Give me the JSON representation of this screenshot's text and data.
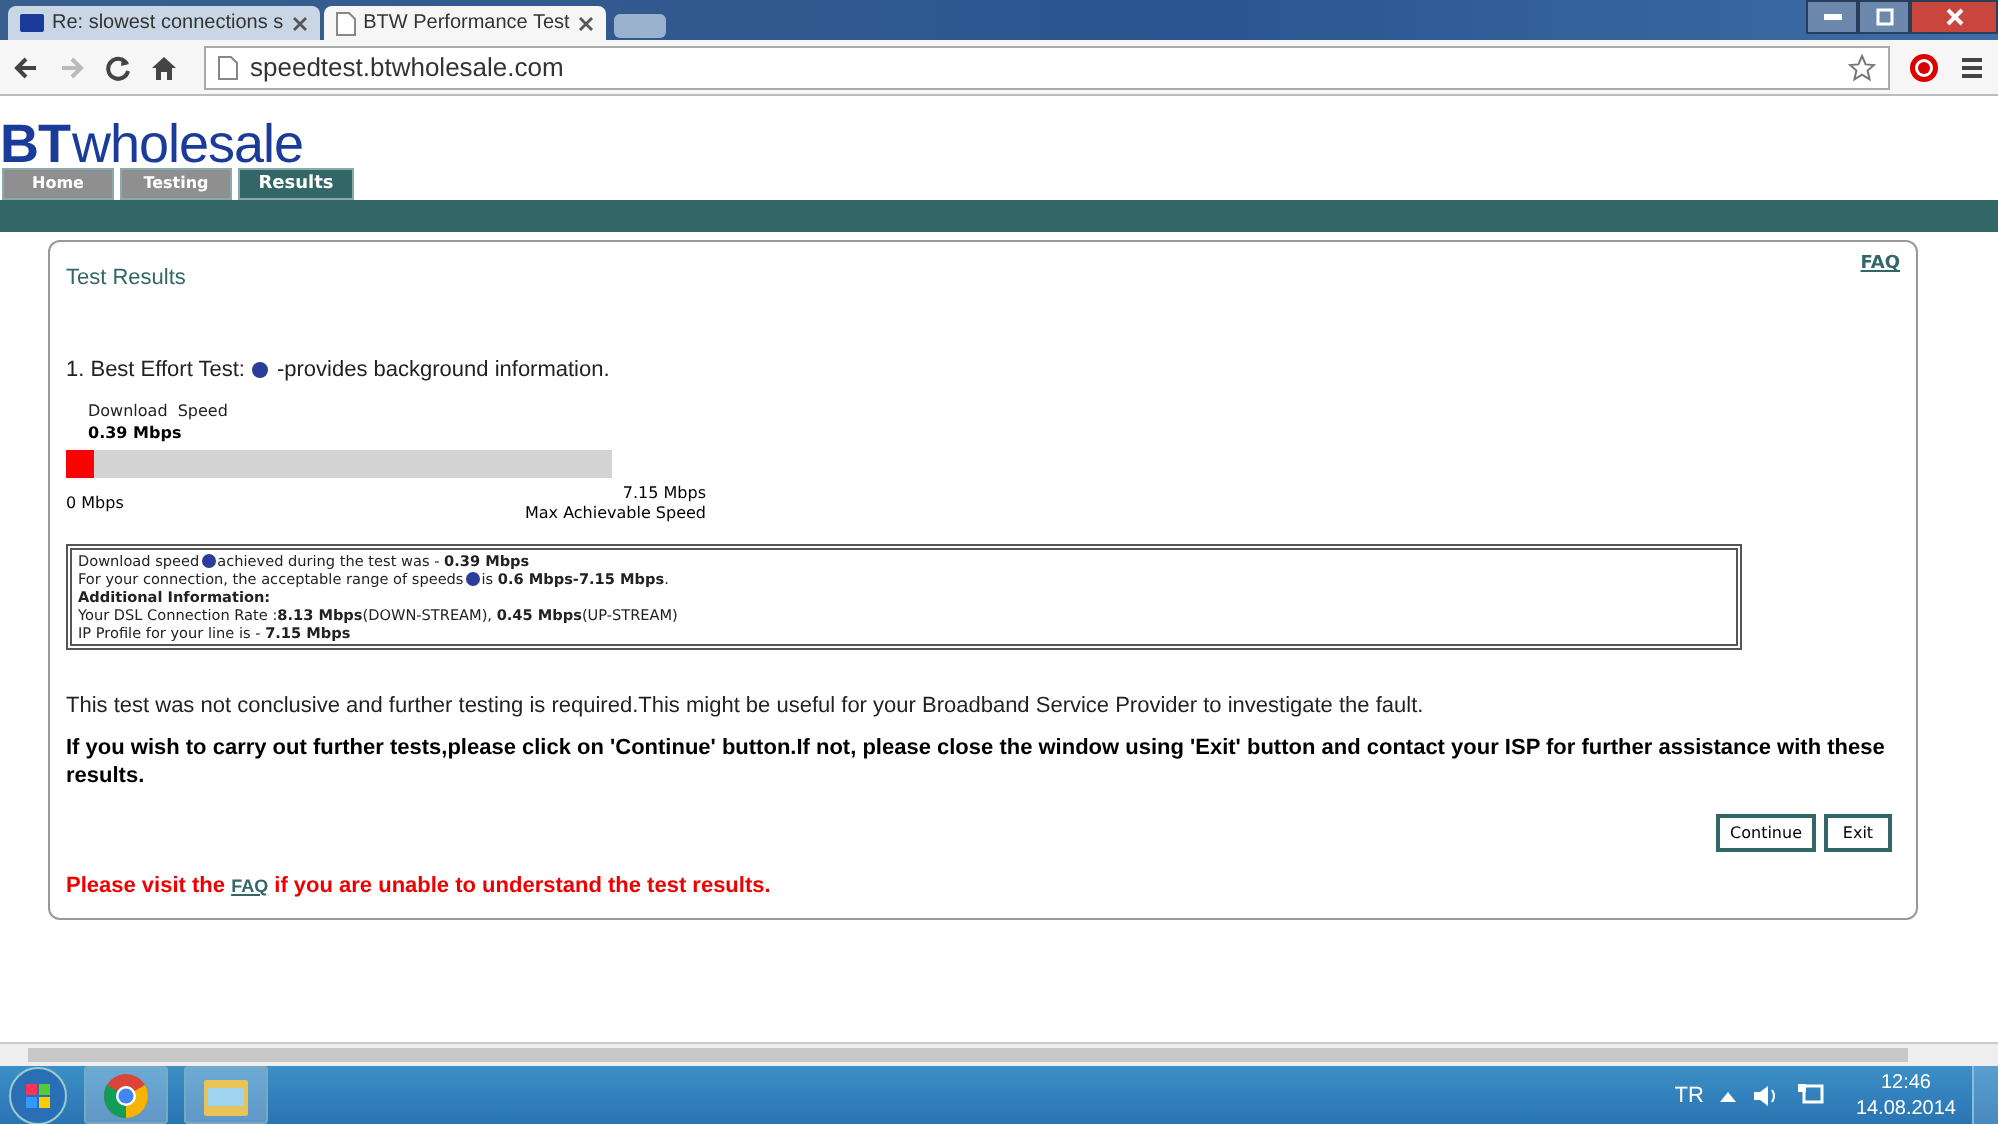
{
  "browser": {
    "tabs": [
      {
        "title": "Re: slowest connections s",
        "selected": false
      },
      {
        "title": "BTW Performance Test",
        "selected": true
      }
    ],
    "address": "speedtest.btwholesale.com"
  },
  "site": {
    "logo": {
      "mark": "BT",
      "word": "wholesale"
    },
    "nav": [
      {
        "label": "Home",
        "selected": false
      },
      {
        "label": "Testing",
        "selected": false
      },
      {
        "label": "Results",
        "selected": true
      }
    ],
    "faq": "FAQ",
    "heading": "Test Results",
    "test": {
      "prefix": "1. Best Effort Test:",
      "suffix": "-provides background information."
    },
    "meter": {
      "label": "Download  Speed",
      "value": "0.39 Mbps",
      "level": 0.05,
      "min": "0 Mbps",
      "max": "7.15 Mbps",
      "max_caption": "Max Achievable Speed"
    },
    "info": [
      {
        "parts": [
          "Download speed",
          "achieved during the test was - **0.39 Mbps**"
        ]
      },
      {
        "parts": [
          "For your connection, the acceptable range of speeds",
          "is **0.6 Mbps-7.15 Mbps**."
        ]
      },
      {
        "parts": [
          "**Additional Information:**"
        ]
      },
      {
        "parts": [
          "Your DSL Connection Rate :**8.13 Mbps**(DOWN-STREAM), **0.45 Mbps**(UP-STREAM)"
        ]
      },
      {
        "parts": [
          "IP Profile for your line is - **7.15 Mbps**"
        ]
      }
    ],
    "message": "This test was not conclusive and further testing is required.This might be useful for your Broadband Service Provider to investigate the fault.",
    "instruction": "If you wish to carry out further tests,please click on 'Continue' button.If not, please close the window using 'Exit' button and contact your ISP for further assistance with these results.",
    "buttons": [
      "Continue",
      "Exit"
    ],
    "note": {
      "before": "Please visit the",
      "link": "FAQ",
      "after": "if you are unable to understand the test results."
    }
  },
  "taskbar": {
    "language": "TR",
    "time": "12:46",
    "date": "14.08.2014"
  }
}
